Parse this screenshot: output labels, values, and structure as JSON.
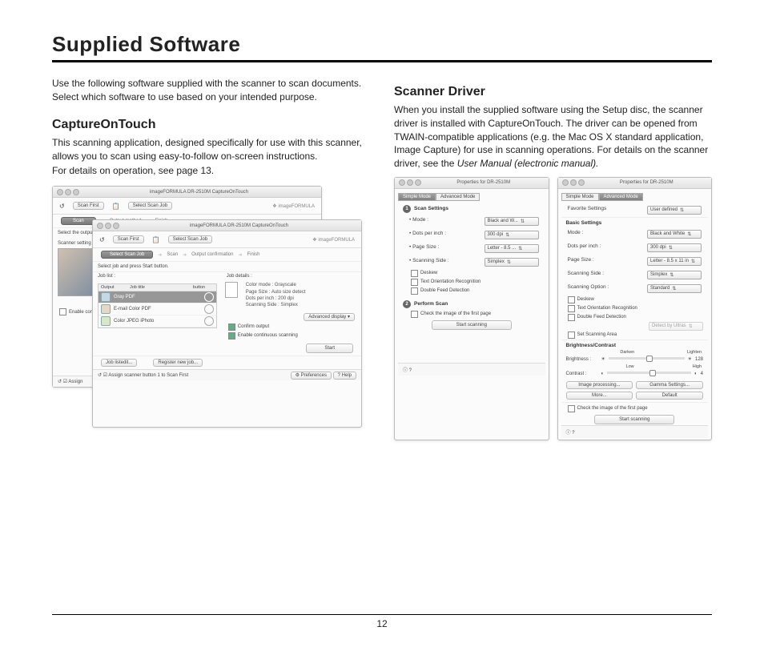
{
  "page_title": "Supplied Software",
  "intro": "Use the following software supplied with the scanner to scan documents. Select which software to use based on your intended purpose.",
  "left": {
    "heading": "CaptureOnTouch",
    "para1": "This scanning application, designed specifically for use with this scanner, allows you to scan using easy-to-follow on-screen instructions.",
    "para2": "For details on operation, see page 13.",
    "window_title": "imageFORMULA DR-2510M CaptureOnTouch",
    "brand": "imageFORMULA",
    "btn_scan_first": "Scan First",
    "btn_select_job": "Select Scan Job",
    "step_scan": "Scan",
    "step_output_method": "Output method",
    "step_output_confirm": "Output confirmation",
    "step_finish": "Finish",
    "select_output_label": "Select the output",
    "scanner_settings": "Scanner setting",
    "select_job_prompt": "Select job and press Start button.",
    "joblist_label": "Job list :",
    "jobdetails_label": "Job details :",
    "col_output": "Output",
    "col_title": "Job title",
    "col_button": "button",
    "job1": "Gray PDF",
    "job2": "E-mail Color PDF",
    "job3": "Color JPEG iPhoto",
    "detail_color": "Color mode :",
    "detail_color_v": "Grayscale",
    "detail_page": "Page Size :",
    "detail_page_v": "Auto size detect",
    "detail_dpi": "Dots per inch :",
    "detail_dpi_v": "200 dpi",
    "detail_side": "Scanning Side :",
    "detail_side_v": "Simplex",
    "adv_display": "Advanced display",
    "ck_confirm": "Confirm output",
    "ck_continuous": "Enable continuous scanning",
    "ck_enable_cont": "Enable cont",
    "btn_start": "Start",
    "btn_joblistedit": "Job listedit...",
    "btn_register": "Register new job...",
    "assign": "Assign scanner button 1 to Scan First",
    "prefs": "Preferences",
    "help": "Help"
  },
  "right": {
    "heading": "Scanner Driver",
    "para": "When you install the supplied software using the Setup disc, the scanner driver is installed with CaptureOnTouch. The driver can be opened from TWAIN-compatible applications (e.g. the Mac OS X standard application, Image Capture) for use in scanning operations. For details on the scanner driver, see the ",
    "para_italic": "User Manual (electronic manual).",
    "props_title": "Properties for DR-2510M",
    "tab_simple": "Simple Mode",
    "tab_advanced": "Advanced Mode",
    "scan_settings": "Scan Settings",
    "mode": "Mode :",
    "mode_v": "Black and W...",
    "dpi": "Dots per inch :",
    "dpi_v": "300 dpi",
    "page_size": "Page Size :",
    "page_size_v_short": "Letter - 8.5 ...",
    "page_size_v_long": "Letter - 8.5 x 11 in",
    "scan_side": "Scanning Side :",
    "scan_side_v": "Simplex",
    "scan_option": "Scanning Option :",
    "scan_option_v": "Standard",
    "ck_deskew": "Deskew",
    "ck_text_orient": "Text Orientation Recognition",
    "ck_double_feed": "Double Feed Detection",
    "detect_ultras": "Detect by Ultras",
    "ck_set_scan_area": "Set Scanning Area",
    "perform_scan": "Perform Scan",
    "ck_first_page": "Check the image of the first page",
    "btn_start_scan": "Start scanning",
    "fav_settings": "Favorite Settings",
    "fav_v": "User defined",
    "basic_settings": "Basic Settings",
    "bc_label": "Brightness/Contrast",
    "brightness": "Brightness :",
    "contrast": "Contrast :",
    "darken": "Darken",
    "lighten": "Lighten",
    "low": "Low",
    "high": "High",
    "b_val": "128",
    "c_val": "4",
    "btn_imgproc": "Image processing...",
    "btn_gamma": "Gamma Settings...",
    "btn_more": "More...",
    "btn_default": "Default"
  },
  "page_number": "12"
}
